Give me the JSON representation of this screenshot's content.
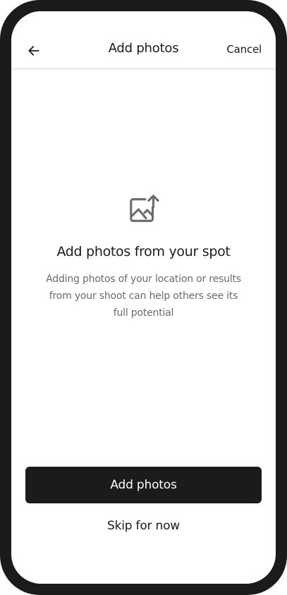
{
  "header": {
    "back_icon": "arrow-left-icon",
    "title": "Add photos",
    "cancel_label": "Cancel"
  },
  "empty_state": {
    "icon": "photo-upload-icon",
    "heading": "Add photos from your spot",
    "description": "Adding photos of your location or results from your shoot can help others see its full potential"
  },
  "actions": {
    "primary_label": "Add photos",
    "secondary_label": "Skip for now"
  },
  "colors": {
    "frame": "#1b1b1b",
    "primary_text": "#1b1b1b",
    "secondary_text": "#6b6b6b",
    "icon": "#6b6b6b",
    "button_bg": "#1b1b1b",
    "button_text": "#ffffff"
  }
}
